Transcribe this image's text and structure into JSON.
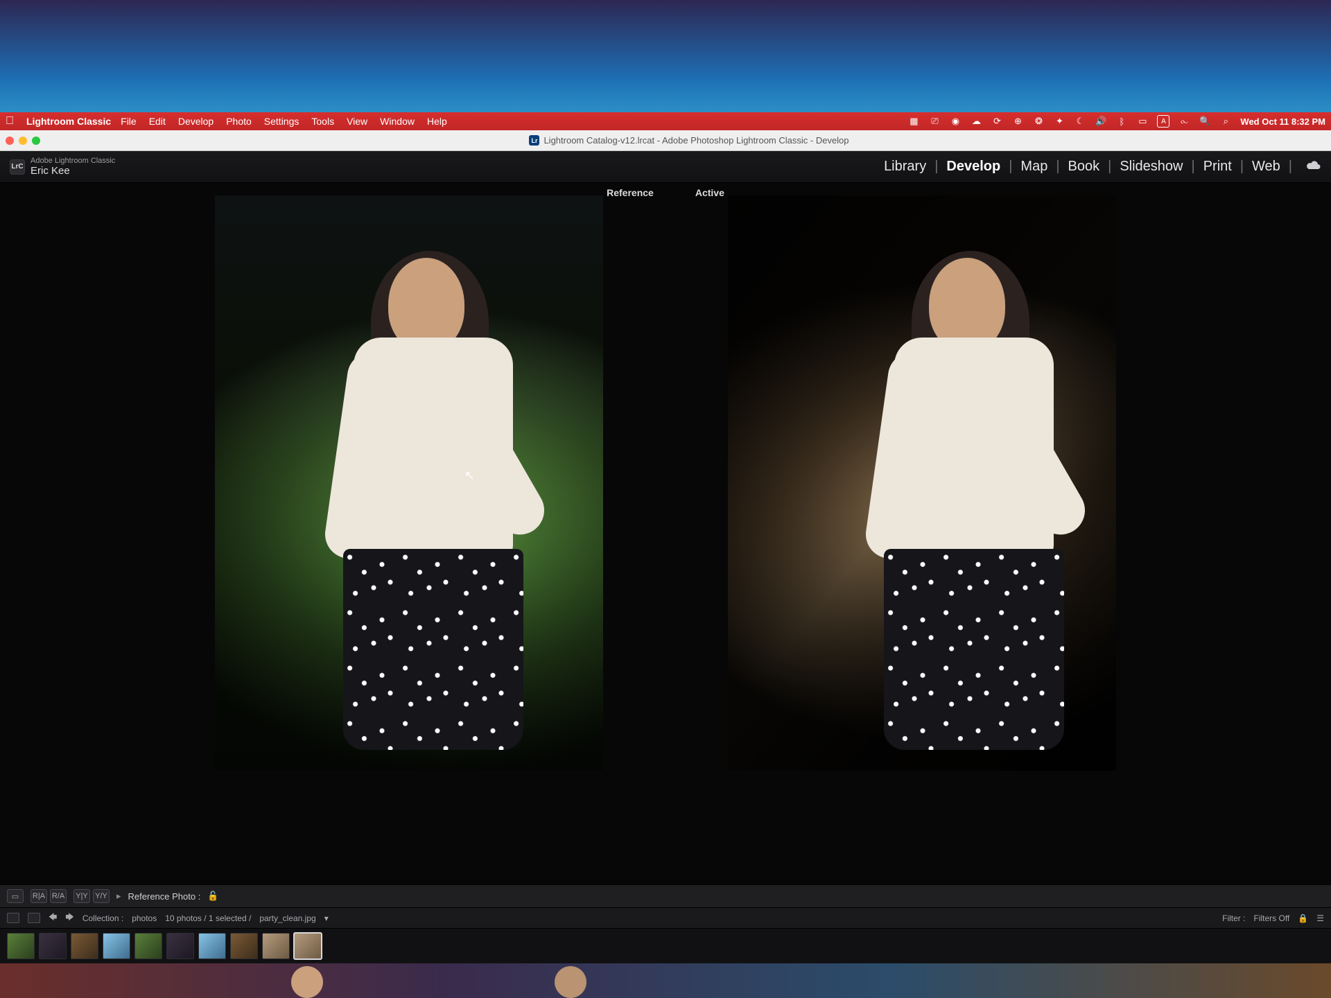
{
  "mac": {
    "app_name": "Lightroom Classic",
    "menus": [
      "File",
      "Edit",
      "Develop",
      "Photo",
      "Settings",
      "Tools",
      "View",
      "Window",
      "Help"
    ],
    "tray_date": "Wed Oct 11  8:32 PM"
  },
  "window": {
    "title": "Lightroom Catalog-v12.lrcat - Adobe Photoshop Lightroom Classic - Develop"
  },
  "identity": {
    "product": "Adobe Lightroom Classic",
    "name": "Eric Kee"
  },
  "modules": {
    "items": [
      "Library",
      "Develop",
      "Map",
      "Book",
      "Slideshow",
      "Print",
      "Web"
    ],
    "active": "Develop"
  },
  "compare": {
    "reference_label": "Reference",
    "active_label": "Active"
  },
  "toolbar": {
    "reference_photo_label": "Reference Photo :"
  },
  "filmstrip": {
    "collection_prefix": "Collection :",
    "collection_name": "photos",
    "count_text": "10 photos / 1 selected /",
    "selected_file": "party_clean.jpg",
    "filter_label": "Filter :",
    "filter_state": "Filters Off"
  }
}
